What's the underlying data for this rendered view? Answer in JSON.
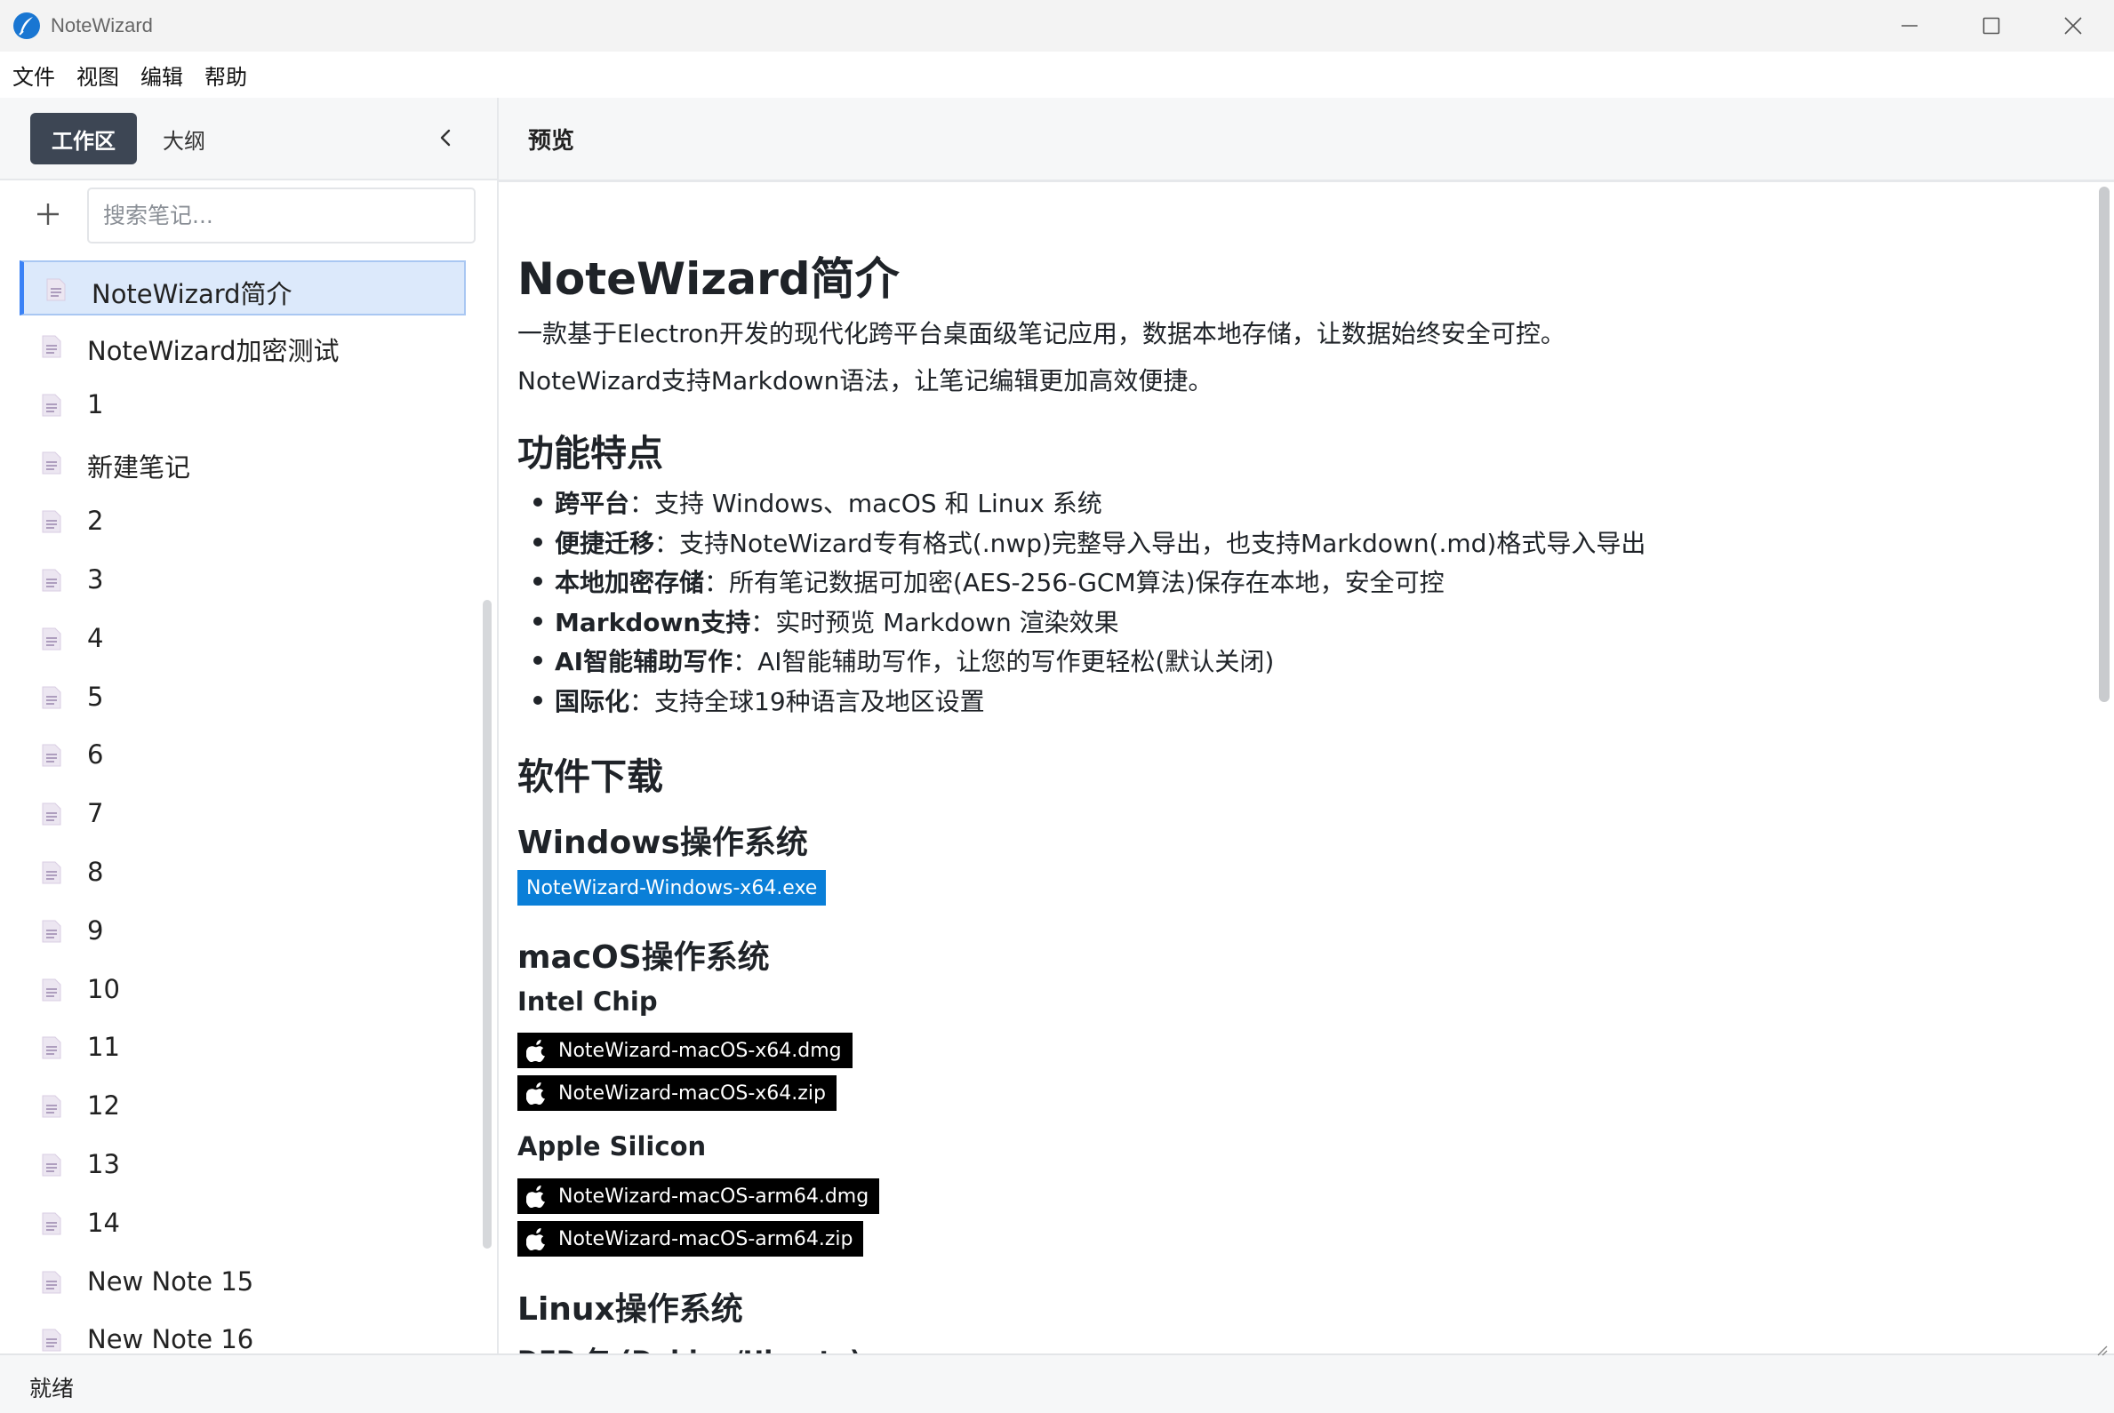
{
  "window": {
    "title": "NoteWizard",
    "logo_icon": "quill-icon",
    "controls": [
      "minimize-icon",
      "maximize-icon",
      "close-icon"
    ]
  },
  "menu": [
    "文件",
    "视图",
    "编辑",
    "帮助"
  ],
  "sidebar": {
    "tabs": {
      "workspace": "工作区",
      "outline": "大纲"
    },
    "collapse_icon": "chevron-left-icon",
    "add_icon": "plus-icon",
    "search_placeholder": "搜索笔记...",
    "notes": [
      "NoteWizard简介",
      "NoteWizard加密测试",
      "1",
      "新建笔记",
      "2",
      "3",
      "4",
      "5",
      "6",
      "7",
      "8",
      "9",
      "10",
      "11",
      "12",
      "13",
      "14",
      "New Note 15",
      "New Note 16"
    ],
    "active_index": 0
  },
  "preview": {
    "header": "预览",
    "h1": "NoteWizard简介",
    "intro1": "一款基于Electron开发的现代化跨平台桌面级笔记应用，数据本地存储，让数据始终安全可控。",
    "intro2": "NoteWizard支持Markdown语法，让笔记编辑更加高效便捷。",
    "features_title": "功能特点",
    "features": [
      {
        "label": "跨平台",
        "text": "：支持 Windows、macOS 和 Linux 系统"
      },
      {
        "label": "便捷迁移",
        "text": "：支持NoteWizard专有格式(.nwp)完整导入导出，也支持Markdown(.md)格式导入导出"
      },
      {
        "label": "本地加密存储",
        "text": "：所有笔记数据可加密(AES-256-GCM算法)保存在本地，安全可控"
      },
      {
        "label": "Markdown支持",
        "text": "：实时预览 Markdown 渲染效果"
      },
      {
        "label": "AI智能辅助写作",
        "text": "：AI智能辅助写作，让您的写作更轻松(默认关闭)"
      },
      {
        "label": "国际化",
        "text": "：支持全球19种语言及地区设置"
      }
    ],
    "download_title": "软件下载",
    "windows_title": "Windows操作系统",
    "windows_download": "NoteWizard-Windows-x64.exe",
    "macos_title": "macOS操作系统",
    "intel_title": "Intel Chip",
    "intel_downloads": [
      "NoteWizard-macOS-x64.dmg",
      "NoteWizard-macOS-x64.zip"
    ],
    "apple_title": "Apple Silicon",
    "apple_downloads": [
      "NoteWizard-macOS-arm64.dmg",
      "NoteWizard-macOS-arm64.zip"
    ],
    "linux_title": "Linux操作系统",
    "deb_title": "DEB 包 (Debian/Ubuntu)"
  },
  "status": "就绪",
  "colors": {
    "accent": "#3b82f6",
    "tab_active_bg": "#3d4654",
    "windows_badge": "#0a7fd8",
    "mac_badge": "#000000"
  }
}
